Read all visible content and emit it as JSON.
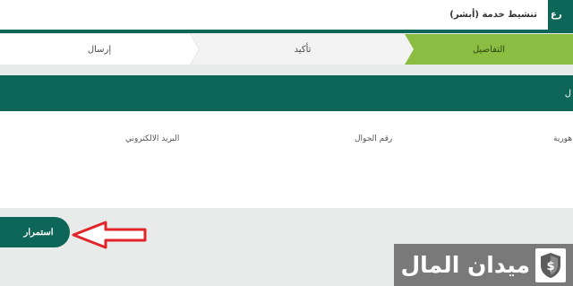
{
  "header": {
    "title": "تنشيط خدمة (أبشر)",
    "tab_label": "رع"
  },
  "steps": {
    "details": "التفاصيل",
    "confirm": "تأكيد",
    "send": "إرسال"
  },
  "section": {
    "header_label": "ل"
  },
  "form": {
    "email_label": "البريد الالكتروني",
    "mobile_label": "رقم الجوال",
    "nationality_label": "هورية"
  },
  "actions": {
    "continue_label": "استمرار"
  },
  "watermark": {
    "text": "ميدان المال"
  },
  "colors": {
    "primary": "#0e6659",
    "step_active": "#8bbd43",
    "annotation_arrow": "#e0262a"
  }
}
